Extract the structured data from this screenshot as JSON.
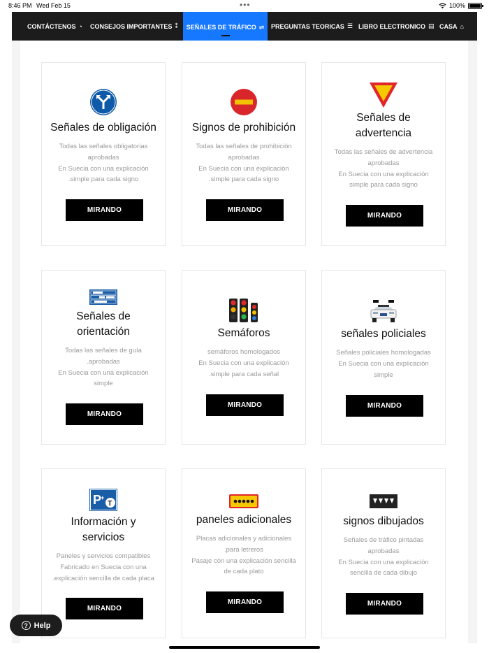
{
  "status": {
    "time": "8:46 PM",
    "date": "Wed Feb 15",
    "battery": "100%"
  },
  "nav": {
    "items": [
      {
        "label": "CONTÁCTENOS",
        "icon": "messenger-icon",
        "glyph": "◔"
      },
      {
        "label": "CONSEJOS IMPORTANTES",
        "icon": "nodes-icon",
        "glyph": "⁑"
      },
      {
        "label": "SEÑALES DE TRÁFICO",
        "icon": "signpost-icon",
        "glyph": "⇌",
        "active": true
      },
      {
        "label": "PREGUNTAS TEORICAS",
        "icon": "list-icon",
        "glyph": "☰"
      },
      {
        "label": "LIBRO ELECTRONICO",
        "icon": "book-icon",
        "glyph": "▤"
      },
      {
        "label": "CASA",
        "icon": "home-icon",
        "glyph": "⌂"
      }
    ]
  },
  "cards": [
    {
      "title": [
        "Señales de obligación"
      ],
      "desc": [
        "Todas las señales obligatorias",
        "aprobadas",
        "En Suecia con una explicación",
        ".simple para cada signo"
      ],
      "button": "MIRANDO",
      "icon": "mandatory-sign-icon"
    },
    {
      "title": [
        "Signos de prohibición"
      ],
      "desc": [
        "Todas las señales de prohibición",
        "aprobadas",
        "En Suecia con una explicación",
        ".simple para cada signo"
      ],
      "button": "MIRANDO",
      "icon": "prohibition-sign-icon"
    },
    {
      "title": [
        "Señales de",
        "advertencia"
      ],
      "desc": [
        "Todas las señales de advertencia",
        "aprobadas",
        "En Suecia con una explicación",
        "simple para cada signo"
      ],
      "button": "MIRANDO",
      "icon": "warning-sign-icon"
    },
    {
      "title": [
        "Señales de",
        "orientación"
      ],
      "desc": [
        "Todas las señales de guía",
        ".aprobadas",
        "En Suecia con una explicación",
        "simple"
      ],
      "button": "MIRANDO",
      "icon": "guide-sign-icon"
    },
    {
      "title": [
        "Semáforos"
      ],
      "desc": [
        "semáforos homologados",
        "En Suecia con una explicación",
        ".simple para cada señal"
      ],
      "button": "MIRANDO",
      "icon": "traffic-lights-icon"
    },
    {
      "title": [
        "señales policiales"
      ],
      "desc": [
        "Señales policiales homologadas",
        "En Suecia con una explicación",
        "simple"
      ],
      "button": "MIRANDO",
      "icon": "police-car-icon"
    },
    {
      "title": [
        "Información y",
        "servicios"
      ],
      "desc": [
        "Paneles y servicios compatibles",
        "Fabricado en Suecia con una",
        ".explicación sencilla de cada placa"
      ],
      "button": "MIRANDO",
      "icon": "parking-sign-icon"
    },
    {
      "title": [
        "paneles adicionales"
      ],
      "desc": [
        "Placas adicionales y adicionales",
        ".para letreros",
        "Pasaje con una explicación sencilla",
        "de cada plato"
      ],
      "button": "MIRANDO",
      "icon": "additional-panel-icon"
    },
    {
      "title": [
        "signos dibujados"
      ],
      "desc": [
        "Señales de tráfico pintadas",
        "aprobadas",
        "En Suecia con una explicación",
        "sencilla de cada dibujo"
      ],
      "button": "MIRANDO",
      "icon": "road-marking-icon"
    }
  ],
  "help": {
    "label": "Help"
  },
  "colors": {
    "nav_bg": "#1c1c1c",
    "nav_active": "#1677ff",
    "button": "#000000"
  }
}
